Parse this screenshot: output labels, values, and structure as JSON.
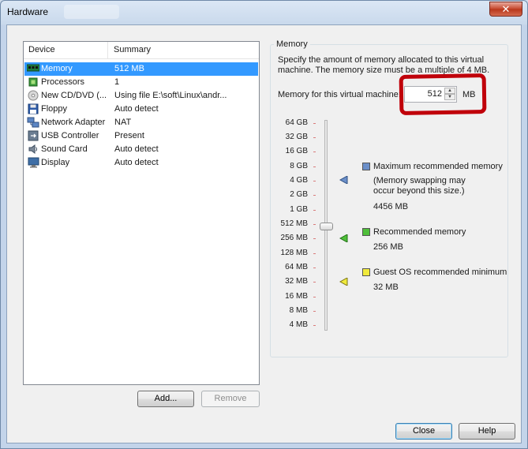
{
  "window": {
    "title": "Hardware",
    "close_glyph": "✕"
  },
  "device_list": {
    "headers": {
      "device": "Device",
      "summary": "Summary"
    },
    "rows": [
      {
        "icon": "memory-icon",
        "name": "Memory",
        "summary": "512 MB",
        "selected": true
      },
      {
        "icon": "processor-icon",
        "name": "Processors",
        "summary": "1"
      },
      {
        "icon": "cd-dvd-icon",
        "name": "New CD/DVD (...",
        "summary": "Using file E:\\soft\\Linux\\andr..."
      },
      {
        "icon": "floppy-icon",
        "name": "Floppy",
        "summary": "Auto detect"
      },
      {
        "icon": "network-adapter-icon",
        "name": "Network Adapter",
        "summary": "NAT"
      },
      {
        "icon": "usb-icon",
        "name": "USB Controller",
        "summary": "Present"
      },
      {
        "icon": "sound-card-icon",
        "name": "Sound Card",
        "summary": "Auto detect"
      },
      {
        "icon": "display-icon",
        "name": "Display",
        "summary": "Auto detect"
      }
    ]
  },
  "buttons": {
    "add": "Add...",
    "remove": "Remove",
    "close": "Close",
    "help": "Help"
  },
  "memory": {
    "group_title": "Memory",
    "description_1": "Specify the amount of memory allocated to this virtual",
    "description_2": "machine. The memory size must be a multiple of 4 MB.",
    "field_label": "Memory for this virtual machine:",
    "value": "512",
    "unit": "MB",
    "scale": [
      "64 GB",
      "32 GB",
      "16 GB",
      "8 GB",
      "4 GB",
      "2 GB",
      "1 GB",
      "512 MB",
      "256 MB",
      "128 MB",
      "64 MB",
      "32 MB",
      "16 MB",
      "8 MB",
      "4 MB"
    ],
    "legend": {
      "max_title": "Maximum recommended memory",
      "max_note_1": "(Memory swapping may",
      "max_note_2": "occur beyond this size.)",
      "max_value": "4456 MB",
      "rec_title": "Recommended memory",
      "rec_value": "256 MB",
      "min_title": "Guest OS recommended minimum",
      "min_value": "32 MB"
    },
    "colors": {
      "max": "#6b8fc9",
      "rec": "#4fbf3a",
      "min": "#f0ea3c",
      "annotation": "#c0000a"
    }
  }
}
